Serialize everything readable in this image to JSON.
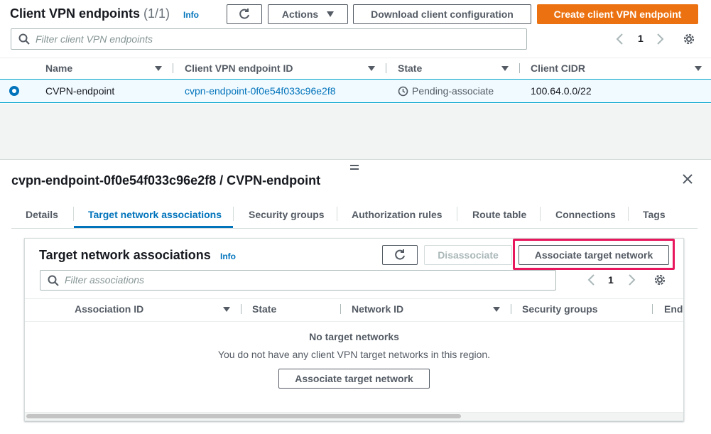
{
  "top": {
    "title": "Client VPN endpoints",
    "count": "(1/1)",
    "info": "Info",
    "actions_label": "Actions",
    "download_label": "Download client configuration",
    "create_label": "Create client VPN endpoint",
    "search_placeholder": "Filter client VPN endpoints",
    "page": "1",
    "columns": [
      "Name",
      "Client VPN endpoint ID",
      "State",
      "Client CIDR"
    ],
    "row": {
      "name": "CVPN-endpoint",
      "id": "cvpn-endpoint-0f0e54f033c96e2f8",
      "state": "Pending-associate",
      "cidr": "100.64.0.0/22"
    }
  },
  "detail": {
    "title": "cvpn-endpoint-0f0e54f033c96e2f8 / CVPN-endpoint",
    "tabs": [
      "Details",
      "Target network associations",
      "Security groups",
      "Authorization rules",
      "Route table",
      "Connections",
      "Tags"
    ],
    "active_tab": "Target network associations"
  },
  "assoc": {
    "title": "Target network associations",
    "info": "Info",
    "disassociate_label": "Disassociate",
    "associate_label": "Associate target network",
    "search_placeholder": "Filter associations",
    "page": "1",
    "columns": [
      "Association ID",
      "State",
      "Network ID",
      "Security groups",
      "Endp"
    ],
    "empty_title": "No target networks",
    "empty_desc": "You do not have any client VPN target networks in this region.",
    "empty_button": "Associate target network"
  },
  "colors": {
    "primary": "#ec7211",
    "link": "#0073bb",
    "selected_row": "#f1faff",
    "highlight": "#e8175d"
  }
}
